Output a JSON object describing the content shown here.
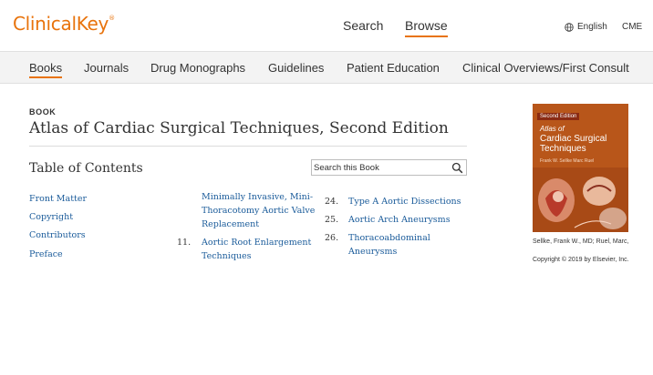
{
  "header": {
    "logo": "ClinicalKey",
    "logo_mark": "®",
    "search_label": "Search",
    "browse_label": "Browse",
    "language_label": "English",
    "cme_label": "CME"
  },
  "subnav": {
    "items": [
      "Books",
      "Journals",
      "Drug Monographs",
      "Guidelines",
      "Patient Education",
      "Clinical Overviews/First Consult"
    ],
    "active": "Books"
  },
  "book": {
    "label": "BOOK",
    "title": "Atlas of Cardiac Surgical Techniques, Second Edition",
    "toc_heading": "Table of Contents",
    "search_placeholder": "Search this Book"
  },
  "toc": {
    "col1": [
      {
        "label": "Front Matter"
      },
      {
        "label": "Copyright"
      },
      {
        "label": "Contributors"
      },
      {
        "label": "Preface"
      }
    ],
    "col2": [
      {
        "num": "",
        "lines": [
          "Minimally Invasive, Mini-",
          "Thoracotomy Aortic Valve",
          "Replacement"
        ]
      },
      {
        "num": "11.",
        "lines": [
          "Aortic Root Enlargement",
          "Techniques"
        ]
      }
    ],
    "col3": [
      {
        "num": "24.",
        "lines": [
          "Type A Aortic Dissections"
        ]
      },
      {
        "num": "25.",
        "lines": [
          "Aortic Arch Aneurysms"
        ]
      },
      {
        "num": "26.",
        "lines": [
          "Thoracoabdominal",
          "Aneurysms"
        ]
      }
    ]
  },
  "cover": {
    "edition": "Second Edition",
    "title_line1": "Atlas of",
    "title_line2": "Cardiac Surgical",
    "title_line3": "Techniques",
    "authors": "Frank W. Sellke  Marc Ruel"
  },
  "sidebar": {
    "authors": "Sellke, Frank W., MD; Ruel, Marc,",
    "copyright": "Copyright © 2019 by Elsevier, Inc."
  },
  "colors": {
    "accent": "#e8730c",
    "link": "#1a5b9a",
    "cover": "#b8561a"
  }
}
